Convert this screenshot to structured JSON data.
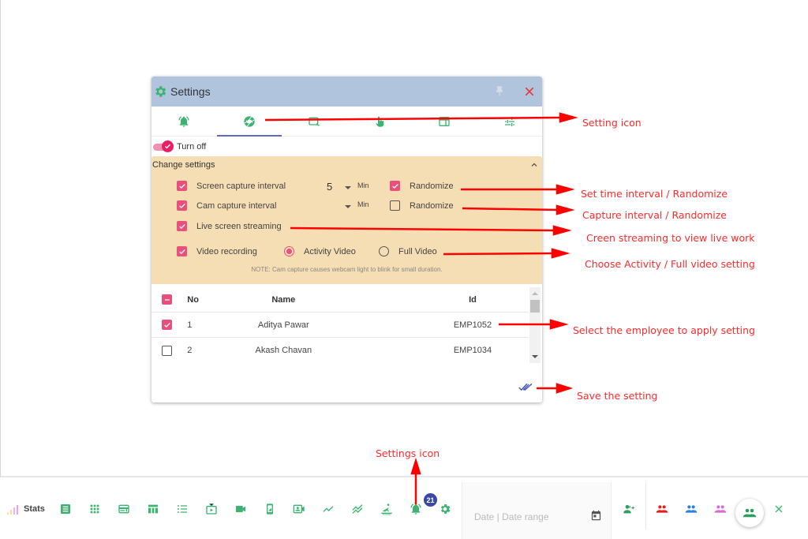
{
  "dialog": {
    "title": "Settings",
    "icons": {
      "title": "gear-icon",
      "pin": "pin-icon",
      "close": "close-icon"
    },
    "tabs": [
      {
        "icon": "alarm-bell-icon",
        "active": false
      },
      {
        "icon": "camera-shutter-icon",
        "active": true
      },
      {
        "icon": "screen-capture-icon",
        "active": false
      },
      {
        "icon": "touch-hand-icon",
        "active": false
      },
      {
        "icon": "browser-window-icon",
        "active": false
      },
      {
        "icon": "sliders-icon",
        "active": false
      }
    ],
    "toggle": {
      "label": "Turn off",
      "on": true
    },
    "panel": {
      "title": "Change settings",
      "screen_capture": {
        "label": "Screen capture interval",
        "checked": true,
        "value": "5",
        "unit": "Min",
        "randomize_label": "Randomize",
        "randomize": true
      },
      "cam_capture": {
        "label": "Cam capture interval",
        "checked": true,
        "value": "",
        "unit": "Min",
        "randomize_label": "Randomize",
        "randomize": false
      },
      "live_streaming": {
        "label": "Live screen streaming",
        "checked": true
      },
      "video_recording": {
        "label": "Video recording",
        "checked": true,
        "options": [
          {
            "label": "Activity Video",
            "selected": true
          },
          {
            "label": "Full Video",
            "selected": false
          }
        ]
      },
      "note": "NOTE: Cam capture causes webcam light to blink for small duration."
    },
    "table": {
      "columns": [
        "No",
        "Name",
        "Id"
      ],
      "select_all_state": "indeterminate",
      "rows": [
        {
          "checked": true,
          "no": "1",
          "name": "Aditya Pawar",
          "id": "EMP1052"
        },
        {
          "checked": false,
          "no": "2",
          "name": "Akash Chavan",
          "id": "EMP1034"
        }
      ]
    },
    "save_icon": "double-check-icon"
  },
  "annotations": {
    "setting_icon": "Setting icon",
    "time_interval": "Set time interval / Randomize",
    "capture_interval": "Capture interval / Randomize",
    "streaming": "Creen streaming to view live work",
    "video": "Choose Activity / Full video setting",
    "select_employee": "Select the employee to apply setting",
    "save": "Save the setting",
    "settings_icon": "Settings icon"
  },
  "toolbar": {
    "stats_label": "Stats",
    "icons": [
      "list-alt-icon",
      "apps-grid-icon",
      "web-window-icon",
      "table-columns-icon",
      "numbered-list-icon",
      "live-tv-icon",
      "videocam-icon",
      "phone-screen-icon",
      "video-call-icon",
      "trend-line-icon",
      "multiline-trend-icon",
      "surfing-icon",
      "alarm-bell-icon",
      "gear-icon"
    ],
    "notification_count": "21",
    "date_placeholder": "Date | Date range",
    "groups": [
      {
        "icon": "add-group-icon",
        "color": "#2e9e5b"
      },
      {
        "icon": "group-icon",
        "color": "#e81c1c"
      },
      {
        "icon": "group-icon",
        "color": "#2a7de1"
      },
      {
        "icon": "group-icon",
        "color": "#d66bd6"
      },
      {
        "icon": "group-icon",
        "color": "#2e9e5b"
      }
    ],
    "close_icon": "close-icon"
  },
  "colors": {
    "accent_green": "#3cb371",
    "checkbox_pink": "#e94f7c",
    "header_blue": "#b0c4de",
    "panel_tan": "#f5deb3",
    "annotation_red": "#ff2a2a",
    "tab_indicator": "#5c6bc0",
    "badge_blue": "#3949ab"
  }
}
